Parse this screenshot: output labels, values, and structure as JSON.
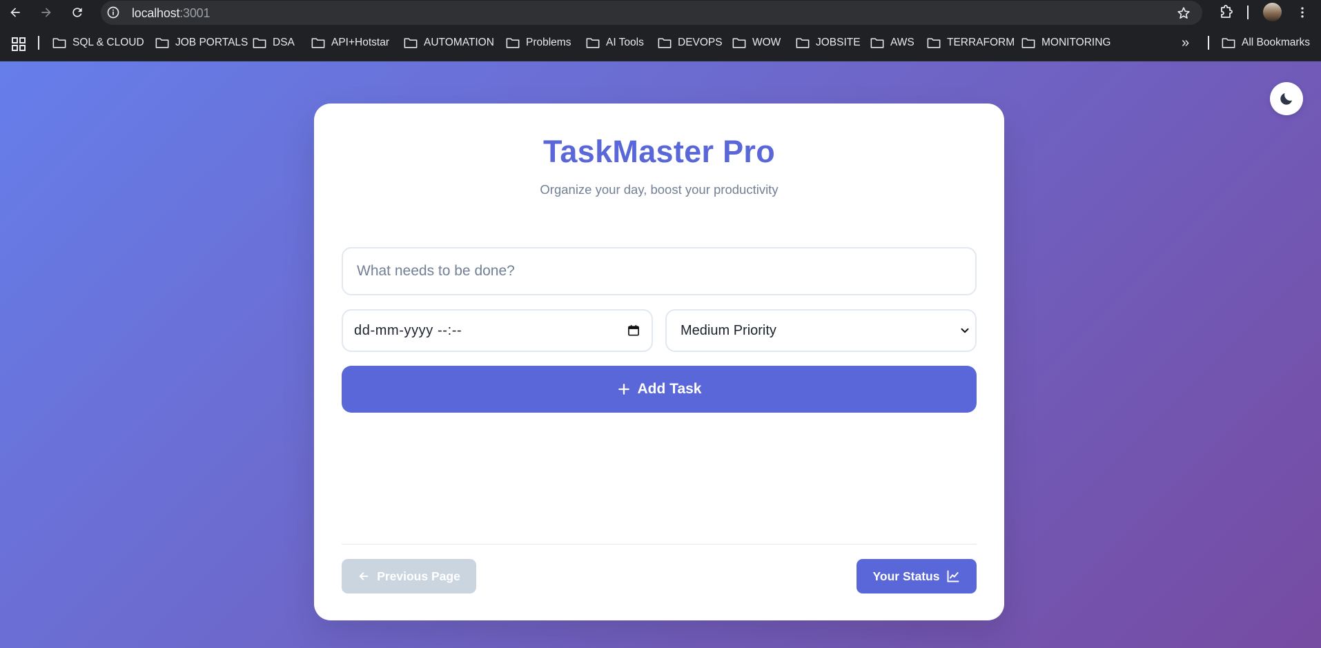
{
  "browser": {
    "url_host": "localhost",
    "url_port": ":3001",
    "back_icon": "arrow-left-icon",
    "forward_icon": "arrow-right-icon",
    "reload_icon": "reload-icon"
  },
  "bookmarks": {
    "items": [
      {
        "label": "SQL & CLOUD"
      },
      {
        "label": "JOB PORTALS"
      },
      {
        "label": "DSA"
      },
      {
        "label": "API+Hotstar"
      },
      {
        "label": "AUTOMATION"
      },
      {
        "label": "Problems"
      },
      {
        "label": "AI Tools"
      },
      {
        "label": "DEVOPS"
      },
      {
        "label": "WOW"
      },
      {
        "label": "JOBSITE"
      },
      {
        "label": "AWS"
      },
      {
        "label": "TERRAFORM"
      },
      {
        "label": "MONITORING"
      }
    ],
    "overflow_label": "»",
    "all_bookmarks_label": "All Bookmarks"
  },
  "app": {
    "title": "TaskMaster Pro",
    "subtitle": "Organize your day, boost your productivity",
    "task_input_placeholder": "What needs to be done?",
    "task_input_value": "",
    "due_date_value": "dd-mm-yyyy --:--",
    "priority_selected": "Medium Priority",
    "add_button_label": "Add Task",
    "previous_button_label": "Previous Page",
    "status_button_label": "Your Status",
    "theme_toggle_icon": "moon-icon"
  },
  "colors": {
    "accent": "#5a67d8",
    "gradient_start": "#667eea",
    "gradient_end": "#764ba2",
    "disabled": "#cbd5e0"
  }
}
